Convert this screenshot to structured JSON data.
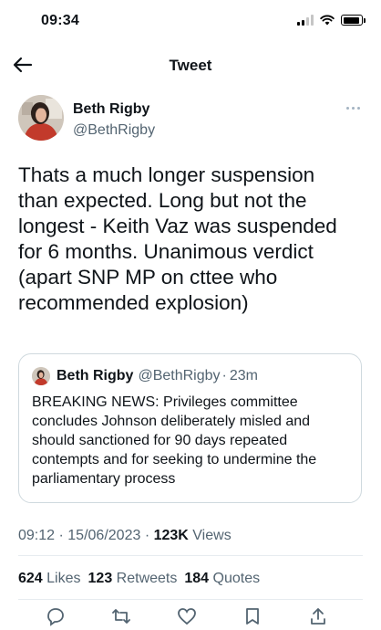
{
  "status_bar": {
    "time": "09:34",
    "signal_bars": 2,
    "battery_level": 0.85
  },
  "nav": {
    "title": "Tweet"
  },
  "author": {
    "name": "Beth Rigby",
    "handle": "@BethRigby"
  },
  "tweet": {
    "text": "Thats a much longer suspension\nthan expected. Long but not the\nlongest - Keith Vaz was suspended\nfor 6 months. Unanimous verdict\n(apart SNP MP on cttee who\nrecommended explosion)"
  },
  "quote": {
    "name": "Beth Rigby",
    "handle": "@BethRigby",
    "separator": "·",
    "time": "23m",
    "text": "BREAKING NEWS: Privileges committee\nconcludes Johnson deliberately misled and\nshould sanctioned for 90 days repeated\ncontempts and for seeking to undermine the\nparliamentary process"
  },
  "meta": {
    "time": "09:12",
    "separator": "·",
    "date": "15/06/2023",
    "views_count": "123K",
    "views_label": "Views"
  },
  "stats": {
    "likes_count": "624",
    "likes_label": "Likes",
    "retweets_count": "123",
    "retweets_label": "Retweets",
    "quotes_count": "184",
    "quotes_label": "Quotes"
  },
  "colors": {
    "text": "#0f1419",
    "secondary": "#536471",
    "border": "#cfd9de"
  },
  "icons": [
    "back-arrow-icon",
    "more-icon",
    "reply-icon",
    "retweet-icon",
    "like-icon",
    "bookmark-icon",
    "share-icon"
  ]
}
